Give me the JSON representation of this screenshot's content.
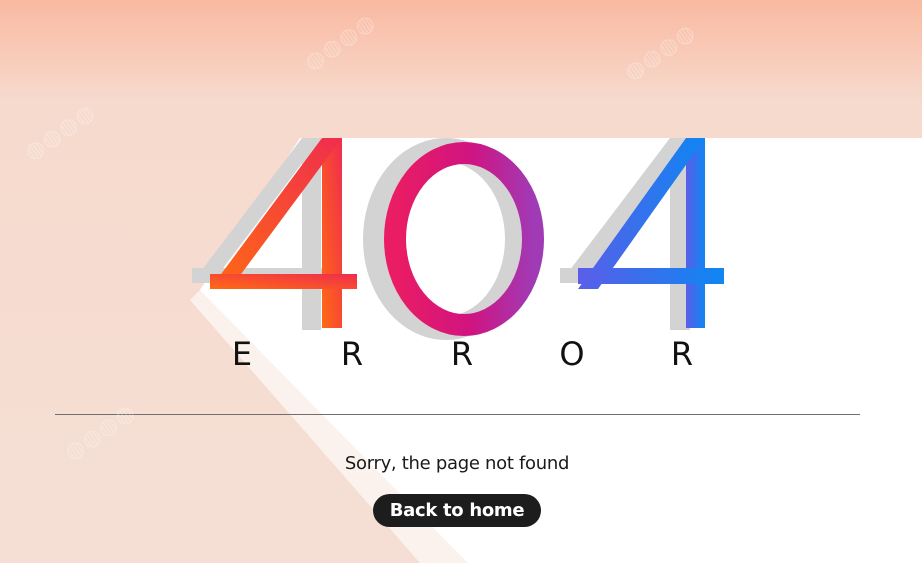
{
  "error_page": {
    "code_digits": [
      "4",
      "0",
      "4"
    ],
    "error_letters": [
      "E",
      "R",
      "R",
      "O",
      "R"
    ],
    "message": "Sorry, the page not found",
    "button_label": "Back to home"
  },
  "colors": {
    "background_top": "#f9b9a1",
    "background": "#f5dfd5",
    "digit_shadow": "#d3d3d3",
    "first_four_gradient": [
      "#ff6a13",
      "#ef2d4e"
    ],
    "zero_gradient": [
      "#ea1c63",
      "#a03ab5"
    ],
    "last_four_gradient": [
      "#5a5ee8",
      "#0f86f2"
    ],
    "button_bg": "#1d1d1d",
    "button_text": "#ffffff"
  },
  "icons": {
    "watermark": "adobe-stock-watermark"
  }
}
